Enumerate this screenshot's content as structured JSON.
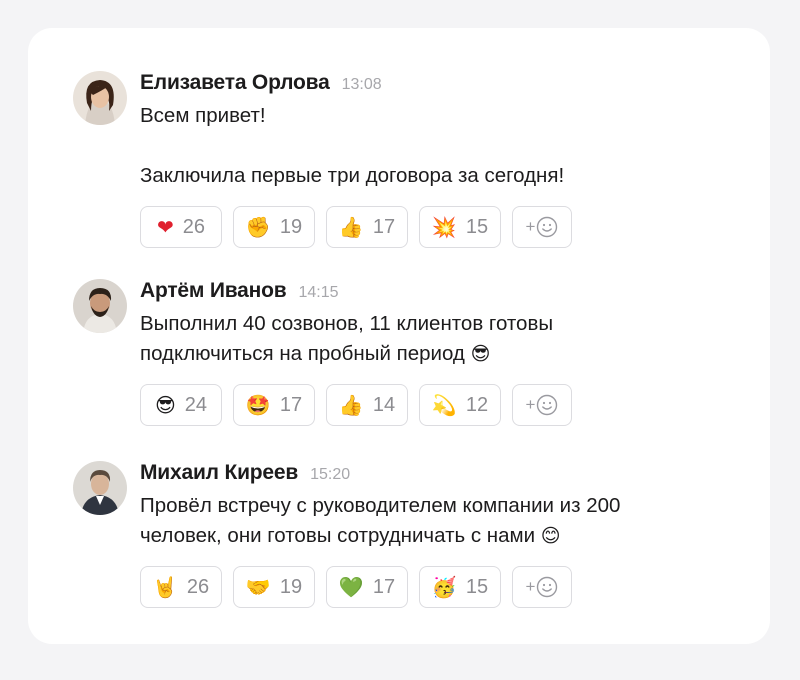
{
  "messages": [
    {
      "author": "Елизавета Орлова",
      "time": "13:08",
      "lines": [
        "Всем привет!",
        "",
        "Заключила первые три договора за сегодня!"
      ],
      "inline_emoji": "",
      "avatar": {
        "bg": "#e9e2da",
        "hair": "#3b2418",
        "skin": "#e8c2a4",
        "shirt": "#d8cfc6"
      },
      "reactions": [
        {
          "emoji": "❤",
          "count": "26"
        },
        {
          "emoji": "✊",
          "count": "19"
        },
        {
          "emoji": "👍",
          "count": "17"
        },
        {
          "emoji": "💥",
          "count": "15"
        }
      ]
    },
    {
      "author": "Артём Иванов",
      "time": "14:15",
      "lines": [
        "Выполнил 40 созвонов, 11 клиентов готовы",
        "подключиться на пробный период"
      ],
      "inline_emoji": "😎",
      "avatar": {
        "bg": "#d9d4ce",
        "hair": "#2c2119",
        "skin": "#c99a7b",
        "shirt": "#ece9e4"
      },
      "reactions": [
        {
          "emoji": "😎",
          "count": "24"
        },
        {
          "emoji": "🤩",
          "count": "17"
        },
        {
          "emoji": "👍",
          "count": "14"
        },
        {
          "emoji": "💫",
          "count": "12"
        }
      ]
    },
    {
      "author": "Михаил Киреев",
      "time": "15:20",
      "lines": [
        "Провёл встречу с руководителем компании из 200",
        "человек, они готовы сотрудничать с нами"
      ],
      "inline_emoji": "😊",
      "avatar": {
        "bg": "#dcd9d4",
        "hair": "#5a4a3d",
        "skin": "#d8b59a",
        "shirt": "#2f3540"
      },
      "reactions": [
        {
          "emoji": "🤘",
          "count": "26"
        },
        {
          "emoji": "🤝",
          "count": "19"
        },
        {
          "emoji": "💚",
          "count": "17"
        },
        {
          "emoji": "🥳",
          "count": "15"
        }
      ]
    }
  ],
  "add_reaction": {
    "plus": "+",
    "icon": "smile-add-icon"
  },
  "colors": {
    "background": "#f4f4f6",
    "card": "#ffffff",
    "muted": "#a7a7ab",
    "border": "#dcdce0"
  }
}
